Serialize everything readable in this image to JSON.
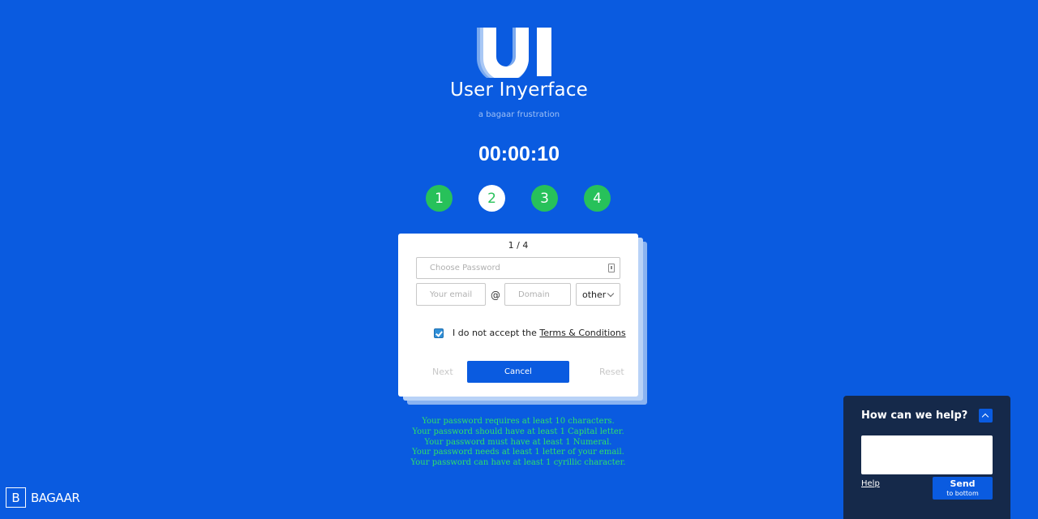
{
  "colors": {
    "background": "#0a5be0",
    "step_complete": "#27c15a",
    "hint_text": "#2fe06a",
    "help_panel": "#15294a"
  },
  "header": {
    "logo_icon": "ui-logo-icon",
    "title": "User Inyerface",
    "subtitle": "a bagaar frustration"
  },
  "timer": "00:00:10",
  "steps": [
    "1",
    "2",
    "3",
    "4"
  ],
  "active_step": "2",
  "form": {
    "page_indicator": "1 / 4",
    "password_placeholder": "Choose Password",
    "email_placeholder": "Your email",
    "at_sign": "@",
    "domain_placeholder": "Domain",
    "tld_selected": "other",
    "terms_checked": true,
    "terms_prefix": "I do not accept the",
    "terms_link": "Terms & Conditions",
    "next_label": "Next",
    "cancel_label": "Cancel",
    "reset_label": "Reset"
  },
  "hints": [
    "Your password requires at least 10 characters.",
    "Your password should have at least 1 Capital letter.",
    "Your password must have at least 1 Numeral.",
    "Your password needs at least 1 letter of your email.",
    "Your password can have at least 1 cyrillic character."
  ],
  "brand": {
    "mark": "B",
    "name": "BAGAAR"
  },
  "help_widget": {
    "title": "How can we help?",
    "help_link": "Help",
    "send_label": "Send",
    "send_sublabel": "to bottom"
  }
}
